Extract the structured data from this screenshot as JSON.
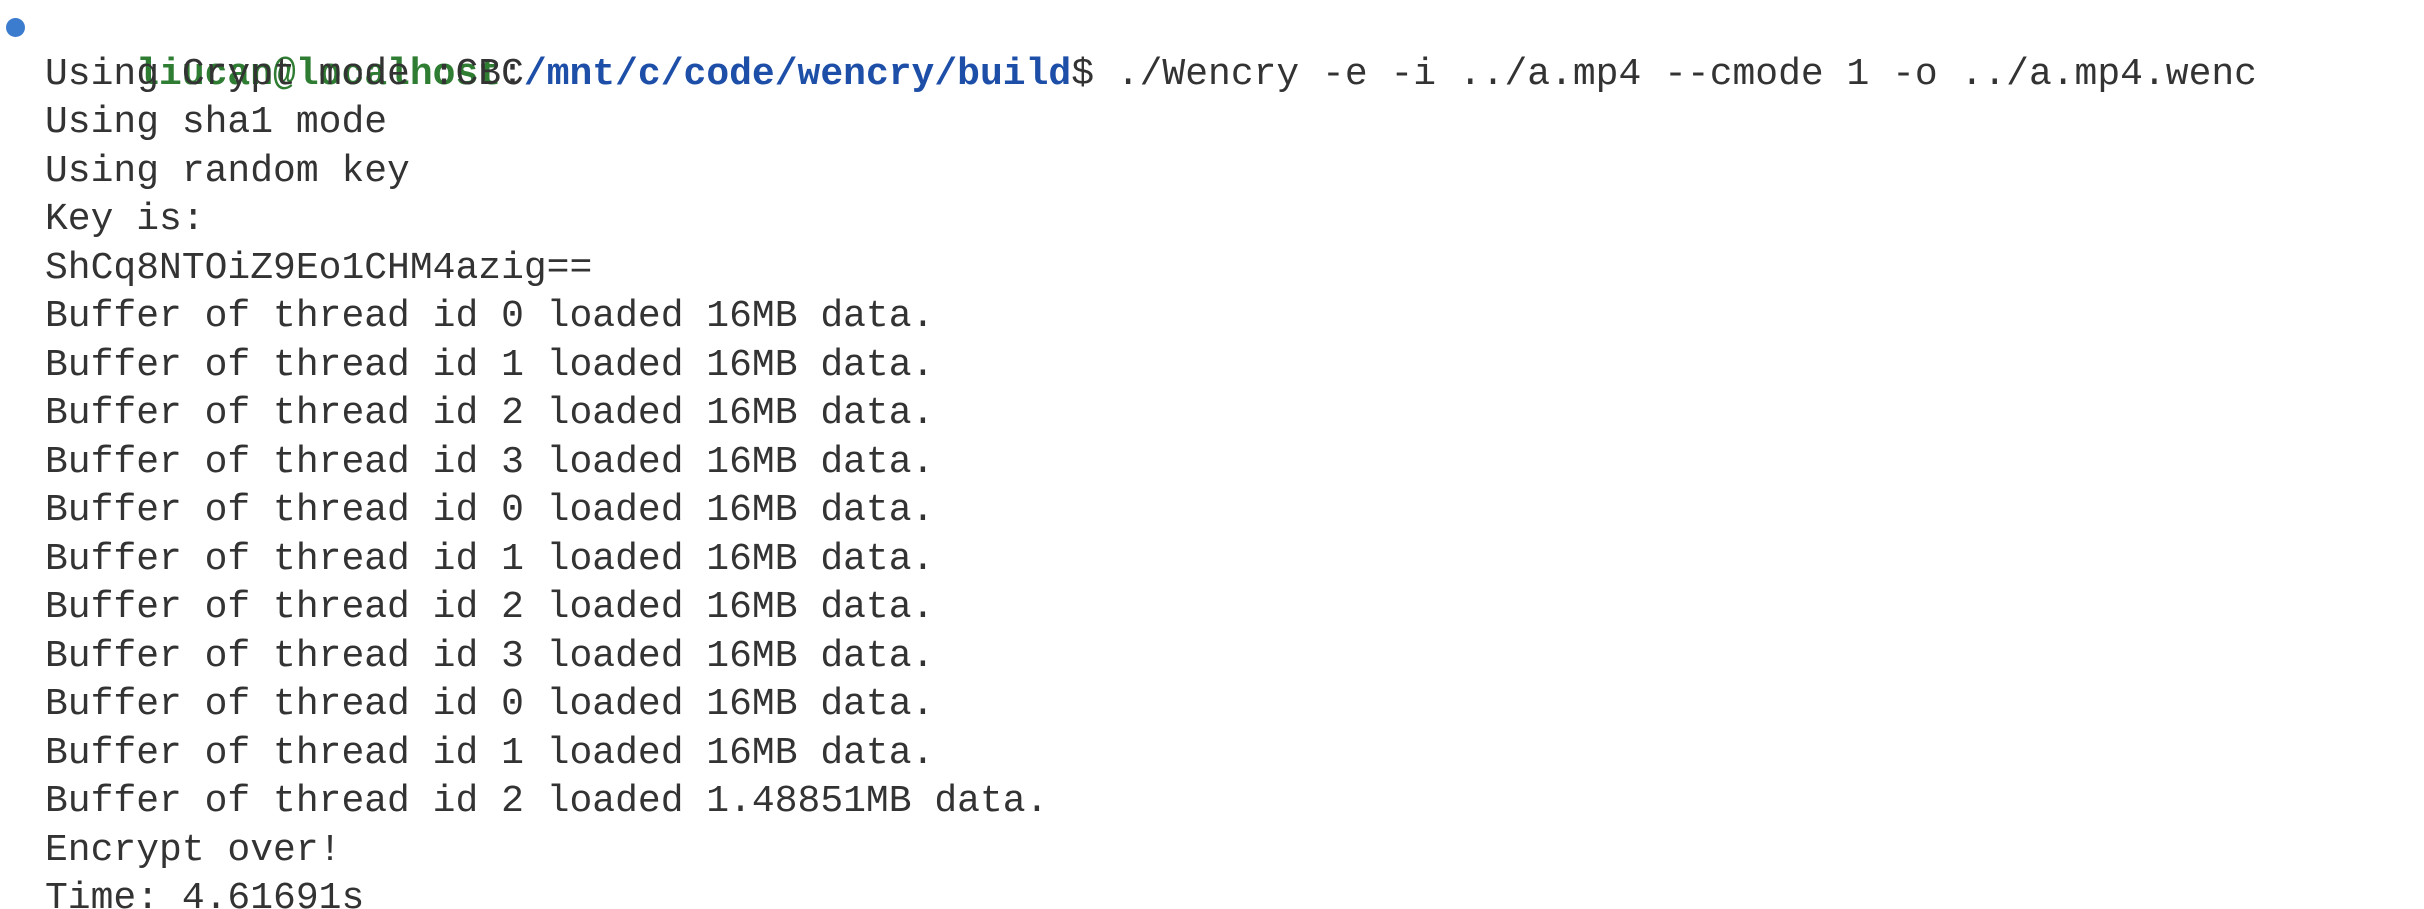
{
  "prompt": {
    "user_host": "liucan@localhost",
    "separator": ":",
    "path": "/mnt/c/code/wencry/build",
    "symbol": "$",
    "command": " ./Wencry -e -i ../a.mp4 --cmode 1 -o ../a.mp4.wenc"
  },
  "output": [
    "Using Crypt mode :CBC",
    "Using sha1 mode",
    "Using random key",
    "Key is:",
    "ShCq8NTOiZ9Eo1CHM4azig==",
    "Buffer of thread id 0 loaded 16MB data.",
    "Buffer of thread id 1 loaded 16MB data.",
    "Buffer of thread id 2 loaded 16MB data.",
    "Buffer of thread id 3 loaded 16MB data.",
    "Buffer of thread id 0 loaded 16MB data.",
    "Buffer of thread id 1 loaded 16MB data.",
    "Buffer of thread id 2 loaded 16MB data.",
    "Buffer of thread id 3 loaded 16MB data.",
    "Buffer of thread id 0 loaded 16MB data.",
    "Buffer of thread id 1 loaded 16MB data.",
    "Buffer of thread id 2 loaded 1.48851MB data.",
    "Encrypt over!",
    "Time: 4.61691s"
  ],
  "colors": {
    "user_host": "#2e7d32",
    "path": "#1e4fa8",
    "status_dot": "#3c7ccf",
    "text": "#333333",
    "background": "#ffffff"
  }
}
